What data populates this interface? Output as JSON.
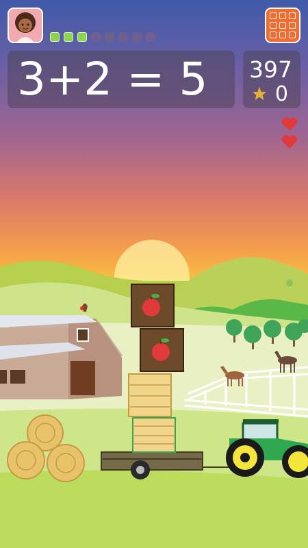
{
  "equation": "3+2 = 5",
  "score": "397",
  "stars": "0",
  "progress": [
    true,
    true,
    true,
    false,
    false,
    false,
    false,
    false
  ],
  "lives": 2,
  "icons": {
    "avatar": "girl-avatar-icon",
    "menu": "grid-menu-icon",
    "star": "star-icon",
    "heart": "heart-icon"
  },
  "colors": {
    "progress_on": "#8fd34a",
    "progress_off": "#6d5f8e",
    "menu": "#f36b2d",
    "heart": "#e23a3a",
    "star": "#e4b23a",
    "tractor": "#2fa84f"
  }
}
